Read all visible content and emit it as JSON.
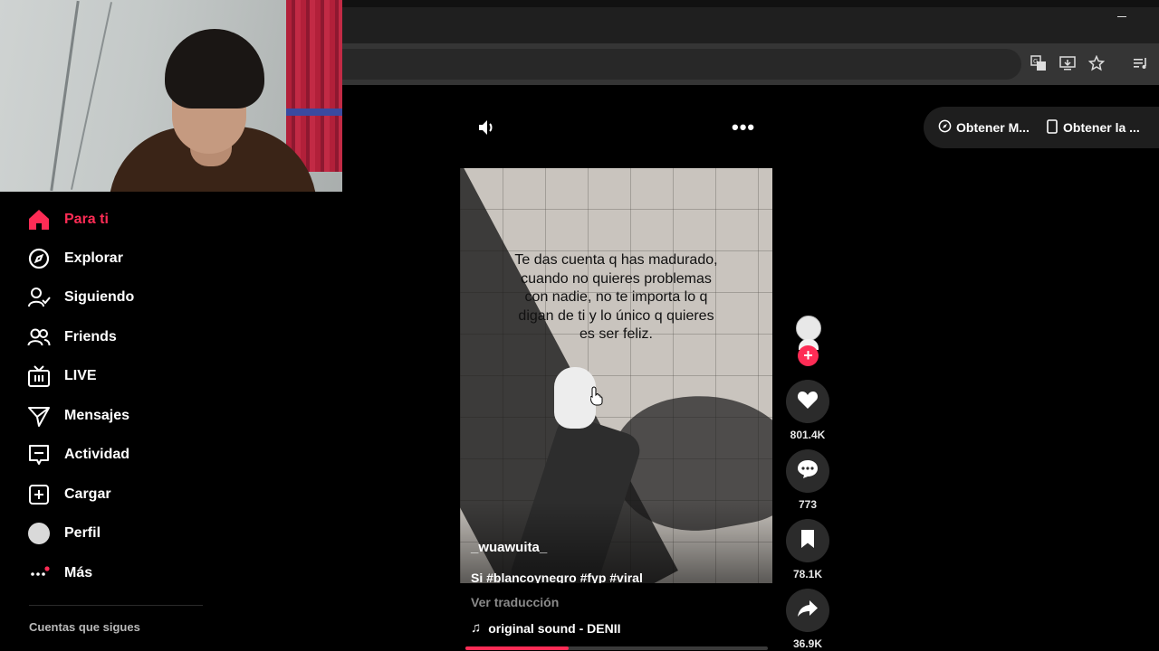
{
  "sidebar": {
    "items": [
      {
        "label": "Para ti",
        "icon": "home-icon"
      },
      {
        "label": "Explorar",
        "icon": "compass-icon"
      },
      {
        "label": "Siguiendo",
        "icon": "user-follow-icon"
      },
      {
        "label": "Friends",
        "icon": "friends-icon"
      },
      {
        "label": "LIVE",
        "icon": "live-tv-icon"
      },
      {
        "label": "Mensajes",
        "icon": "send-icon"
      },
      {
        "label": "Actividad",
        "icon": "activity-icon"
      },
      {
        "label": "Cargar",
        "icon": "upload-icon"
      },
      {
        "label": "Perfil",
        "icon": "avatar"
      },
      {
        "label": "Más",
        "icon": "more-icon"
      }
    ],
    "section_title": "Cuentas que sigues"
  },
  "top_actions": {
    "get_m_label": "Obtener M...",
    "get_app_label": "Obtener la ..."
  },
  "video": {
    "overlay_text": "Te das cuenta q has madurado, cuando no quieres problemas con nadie, no te importa lo q digan de ti y lo único q quieres es ser feliz.",
    "author": "_wuawuita_",
    "caption": "Si #blancoynegro #fyp #viral",
    "translate_label": "Ver traducción",
    "sound_label": "original sound - DENII",
    "progress": 0.34
  },
  "actions": {
    "likes": "801.4K",
    "comments": "773",
    "saves": "78.1K",
    "shares": "36.9K"
  },
  "colors": {
    "accent": "#fe2c55",
    "background": "#000000"
  }
}
